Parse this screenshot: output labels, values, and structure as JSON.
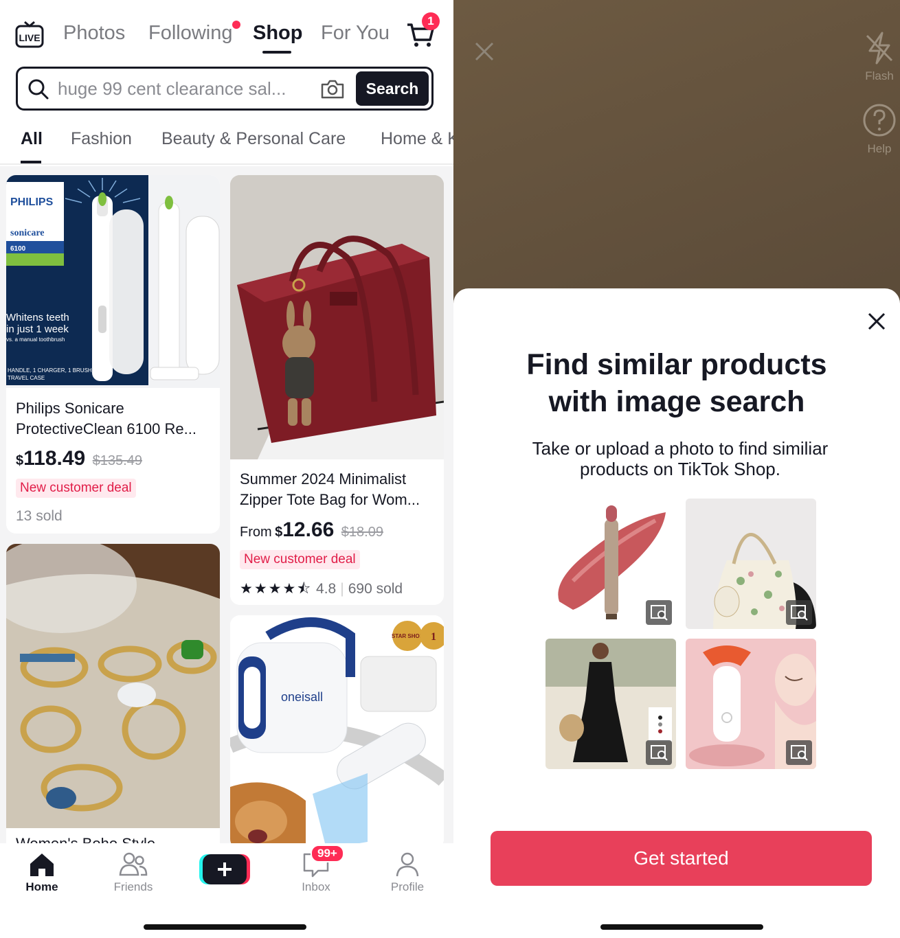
{
  "top_nav": {
    "live_label": "LIVE",
    "tabs": [
      "Photos",
      "Following",
      "Shop",
      "For You"
    ],
    "active_tab": "Shop",
    "cart_badge": "1"
  },
  "search": {
    "query": "huge 99 cent clearance sal...",
    "button_label": "Search"
  },
  "categories": {
    "items": [
      "All",
      "Fashion",
      "Beauty & Personal Care",
      "Home & K"
    ],
    "active": "All"
  },
  "products": [
    {
      "title_line1": "Philips Sonicare",
      "title_line2": "ProtectiveClean 6100 Re...",
      "price_currency": "$",
      "price": "118.49",
      "old_price": "$135.49",
      "deal": "New customer deal",
      "sold": "13 sold",
      "image_text": {
        "brand": "PHILIPS",
        "line": "sonicare",
        "model": "6100",
        "claim1": "Whitens teeth",
        "claim2": "in just 1 week",
        "claim3": "vs. a manual toothbrush",
        "contents1": "HANDLE, 1 CHARGER, 1 BRUSH HEAD,",
        "contents2": "TRAVEL CASE"
      }
    },
    {
      "title_line1": "Summer 2024 Minimalist",
      "title_line2": "Zipper Tote Bag for Wom...",
      "price_prefix": "From",
      "price_currency": "$",
      "price": "12.66",
      "old_price": "$18.09",
      "deal": "New customer deal",
      "rating": "4.8",
      "sold": "690 sold"
    },
    {
      "title_line1": "Women's Boho Style..."
    },
    {
      "image_text": {
        "brand": "oneisall",
        "badge1": "STAR SHOP",
        "badge2": "1"
      }
    }
  ],
  "bottom_nav": {
    "tabs": [
      "Home",
      "Friends",
      "Inbox",
      "Profile"
    ],
    "active": "Home",
    "inbox_badge": "99+"
  },
  "camera": {
    "flash_label": "Flash",
    "help_label": "Help"
  },
  "sheet": {
    "title_line1": "Find similar products",
    "title_line2": "with image search",
    "subtitle_line1": "Take or upload a photo to find similiar",
    "subtitle_line2": "products on TikTok Shop.",
    "cta": "Get started",
    "examples": [
      "lip-gloss",
      "floral-tote-bag",
      "black-sundress",
      "neck-massager"
    ]
  },
  "colors": {
    "accent": "#fe2c55",
    "cta": "#e8405a",
    "text": "#161823",
    "muted": "#8a8b91"
  }
}
